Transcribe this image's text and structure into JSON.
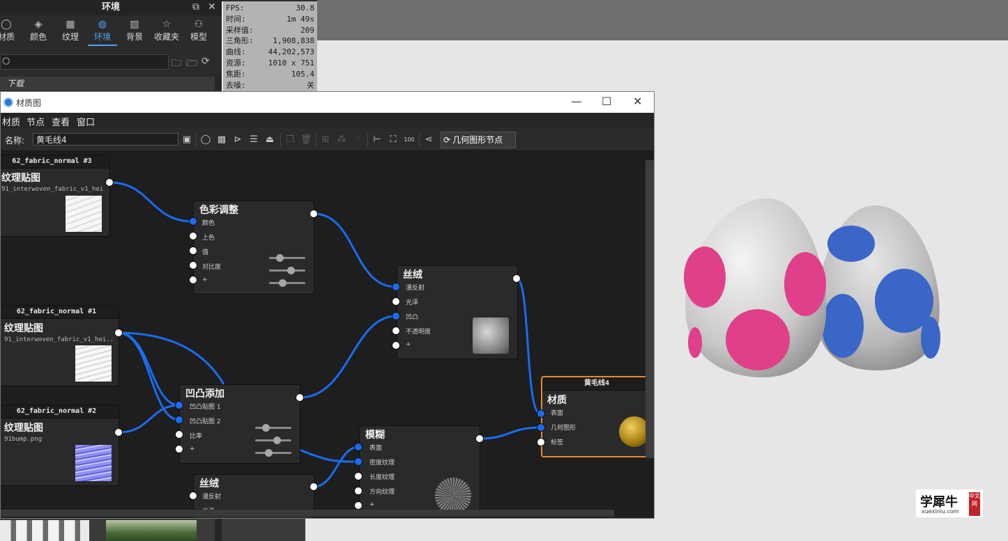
{
  "env_panel": {
    "title": "环境",
    "tabs": [
      {
        "label": "材质",
        "icon": "sphere-icon"
      },
      {
        "label": "颜色",
        "icon": "paint-bucket-icon"
      },
      {
        "label": "纹理",
        "icon": "checker-icon"
      },
      {
        "label": "环境",
        "icon": "globe-icon"
      },
      {
        "label": "背景",
        "icon": "image-icon"
      },
      {
        "label": "收藏夹",
        "icon": "star-icon"
      },
      {
        "label": "模型",
        "icon": "models-icon"
      }
    ],
    "active_tab": "环境",
    "download_label": "下载"
  },
  "stats": [
    {
      "label": "FPS:",
      "value": "30.8"
    },
    {
      "label": "时间:",
      "value": "1m 49s"
    },
    {
      "label": "采样值:",
      "value": "209"
    },
    {
      "label": "三角形:",
      "value": "1,908,838"
    },
    {
      "label": "曲线:",
      "value": "44,202,573"
    },
    {
      "label": "资源:",
      "value": "1010 x 751"
    },
    {
      "label": "焦距:",
      "value": "105.4"
    },
    {
      "label": "去噪:",
      "value": "关"
    }
  ],
  "window": {
    "title": "材质图",
    "controls": {
      "minimize": "—",
      "maximize": "☐",
      "close": "✕"
    },
    "menu": [
      "材质",
      "节点",
      "查看",
      "窗口"
    ],
    "name_label": "名称:",
    "name_value": "黄毛线4",
    "geometry_button": "几何图形节点"
  },
  "nodes": {
    "tex3": {
      "header": "62_fabric_normal #3",
      "title": "纹理贴图",
      "file": "91_interwoven_fabric_v1_hei..."
    },
    "tex1": {
      "header": "62_fabric_normal #1",
      "title": "纹理贴图",
      "file": "91_interwoven_fabric_v1_hei..."
    },
    "tex2": {
      "header": "62_fabric_normal #2",
      "title": "纹理贴图",
      "file": "91bump.png"
    },
    "color_adjust": {
      "title": "色彩调整",
      "inputs": [
        "颜色",
        "上色",
        "值",
        "对比度",
        "+"
      ]
    },
    "silk1": {
      "title": "丝绒",
      "inputs": [
        "漫反射",
        "光泽",
        "凹凸",
        "不透明度",
        "+"
      ]
    },
    "bump_add": {
      "title": "凹凸添加",
      "inputs": [
        "凹凸贴图 1",
        "凹凸贴图 2",
        "比率",
        "+"
      ]
    },
    "blur": {
      "title": "模糊",
      "inputs": [
        "表面",
        "密度纹理",
        "长度纹理",
        "方向纹理",
        "+"
      ]
    },
    "silk2": {
      "title": "丝绒",
      "inputs": [
        "漫反射",
        "光泽"
      ]
    },
    "material": {
      "header": "黄毛线4",
      "title": "材质",
      "inputs": [
        "表面",
        "几何图形",
        "标签"
      ]
    }
  },
  "watermark": {
    "main": "学犀牛",
    "sub": "xuexiniu.com",
    "badge": "中文网"
  },
  "colors": {
    "wire": "#1a6cf2",
    "selected": "#e88a2e",
    "pink": "#e0408a",
    "blue": "#3a66c8"
  }
}
